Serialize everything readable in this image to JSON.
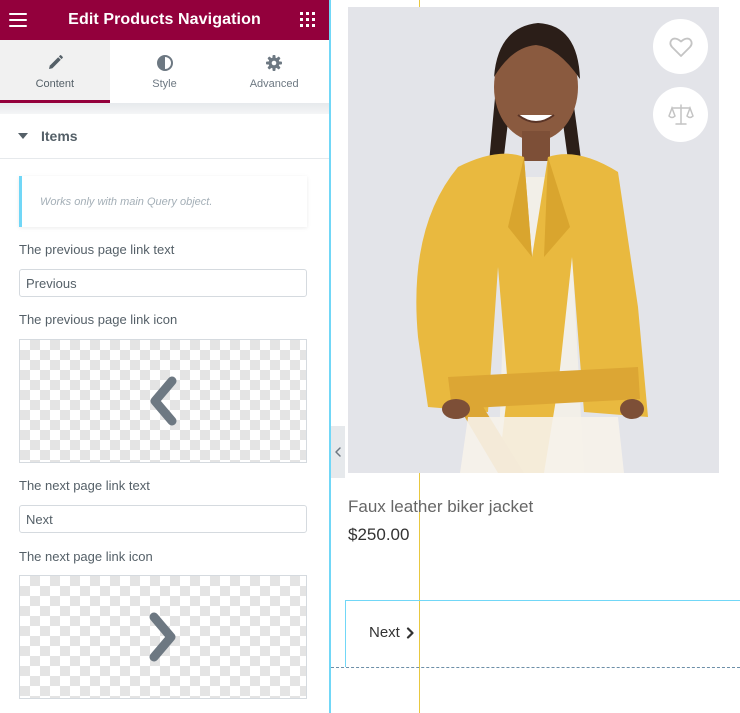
{
  "panel": {
    "title": "Edit Products Navigation",
    "header_color": "#93003c",
    "tabs": [
      {
        "label": "Content",
        "icon": "pencil-icon",
        "active": true
      },
      {
        "label": "Style",
        "icon": "half-circle-icon",
        "active": false
      },
      {
        "label": "Advanced",
        "icon": "gear-icon",
        "active": false
      }
    ],
    "section_title": "Items",
    "notice": "Works only with main Query object.",
    "controls": {
      "prev_text_label": "The previous page link text",
      "prev_text_value": "Previous",
      "prev_icon_label": "The previous page link icon",
      "prev_icon": "chevron-left-icon",
      "next_text_label": "The next page link text",
      "next_text_value": "Next",
      "next_icon_label": "The next page link icon",
      "next_icon": "chevron-right-icon"
    }
  },
  "preview": {
    "product": {
      "title": "Faux leather biker jacket",
      "price": "$250.00",
      "image": "woman-yellow-leather-jacket-photo"
    },
    "actions": [
      "heart-icon",
      "scales-compare-icon"
    ],
    "navigation": {
      "next_label": "Next"
    }
  }
}
